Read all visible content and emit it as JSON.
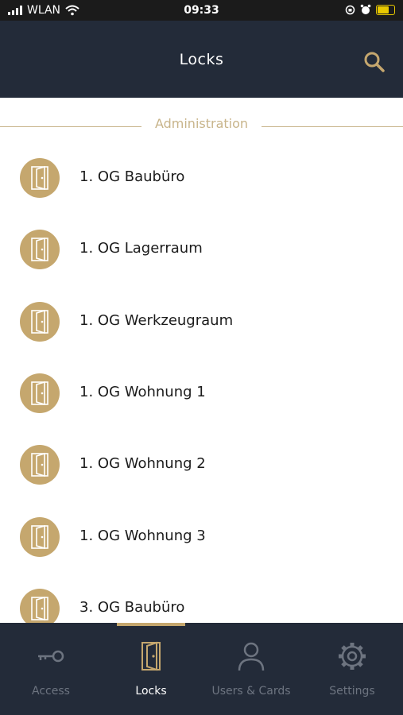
{
  "status": {
    "carrier": "WLAN",
    "time": "09:33"
  },
  "header": {
    "title": "Locks"
  },
  "section": {
    "label": "Administration"
  },
  "locks": [
    {
      "name": "1.  OG Baubüro"
    },
    {
      "name": "1.  OG Lagerraum"
    },
    {
      "name": "1.  OG Werkzeugraum"
    },
    {
      "name": "1.  OG Wohnung 1"
    },
    {
      "name": "1.  OG Wohnung 2"
    },
    {
      "name": "1.  OG Wohnung 3"
    },
    {
      "name": "3.  OG Baubüro"
    }
  ],
  "tabs": [
    {
      "label": "Access",
      "icon": "key-icon"
    },
    {
      "label": "Locks",
      "icon": "door-icon"
    },
    {
      "label": "Users & Cards",
      "icon": "user-icon"
    },
    {
      "label": "Settings",
      "icon": "gear-icon"
    }
  ],
  "colors": {
    "accent": "#c5a76e",
    "header": "#232b39",
    "section_line": "#c8b48a"
  }
}
